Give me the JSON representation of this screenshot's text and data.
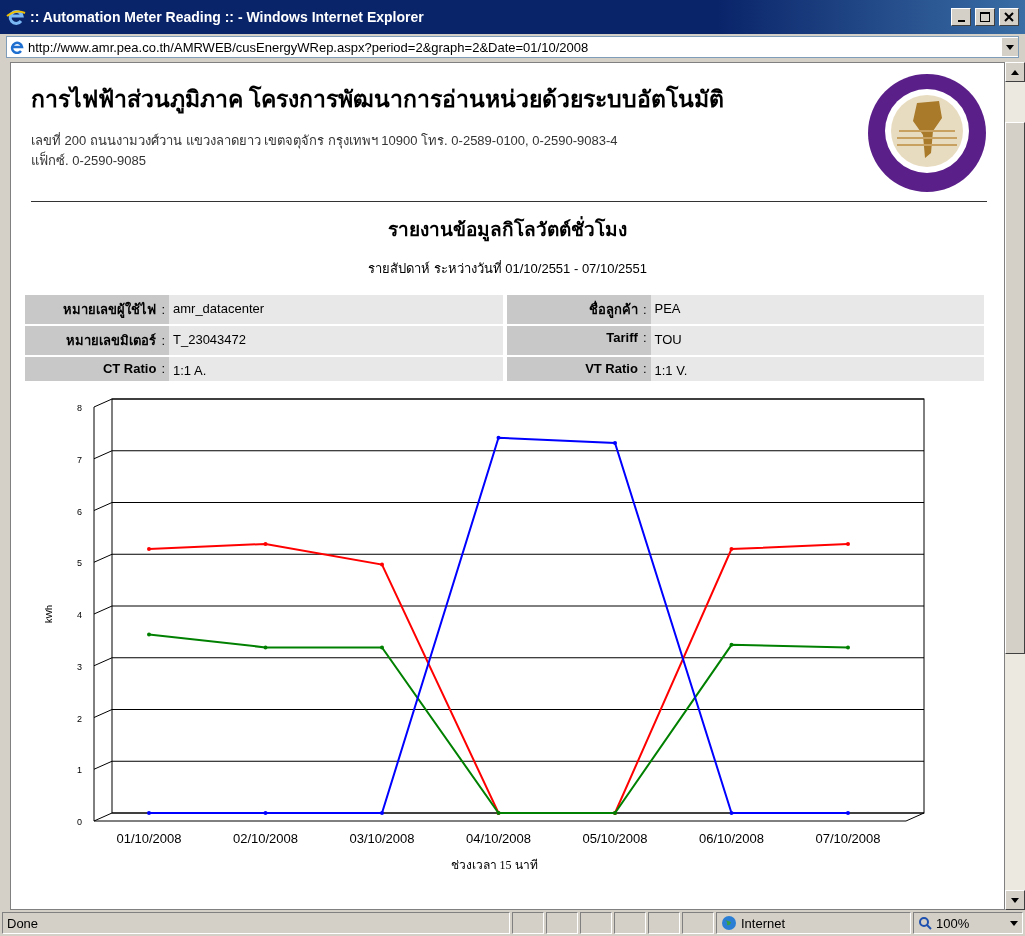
{
  "window": {
    "title": ":: Automation Meter Reading :: - Windows Internet Explorer",
    "address": "http://www.amr.pea.co.th/AMRWEB/cusEnergyWRep.aspx?period=2&graph=2&Date=01/10/2008"
  },
  "header": {
    "title": "การไฟฟ้าส่วนภูมิภาค โครงการพัฒนาการอ่านหน่วยด้วยระบบอัตโนมัติ",
    "address_lines": [
      "เลขที่ 200 ถนนงามวงศ์วาน แขวงลาดยาว เขตจตุจักร กรุงเทพฯ 10900 โทร. 0-2589-0100, 0-2590-9083-4",
      "แฟ็กซ์. 0-2590-9085"
    ]
  },
  "report": {
    "title": "รายงานข้อมูลกิโลวัตต์ชั่วโมง",
    "subtitle": "รายสัปดาห์ ระหว่างวันที่ 01/10/2551 - 07/10/2551",
    "info": [
      [
        {
          "label": "หมายเลขผู้ใช้ไฟ",
          "separator": ":",
          "value": "amr_datacenter"
        },
        {
          "label": "ชื่อลูกค้า",
          "separator": ":",
          "value": "PEA"
        }
      ],
      [
        {
          "label": "หมายเลขมิเตอร์",
          "separator": ":",
          "value": "T_23043472"
        },
        {
          "label": "Tariff",
          "separator": ":",
          "value": "TOU"
        }
      ],
      [
        {
          "label": "CT Ratio",
          "separator": ":",
          "value": "1:1 A."
        },
        {
          "label": "VT Ratio",
          "separator": ":",
          "value": "1:1 V."
        }
      ]
    ],
    "chart_data": {
      "type": "line",
      "xlabel": "ช่วงเวลา 15 นาที",
      "ylabel": "kWh",
      "categories": [
        "01/10/2008",
        "02/10/2008",
        "03/10/2008",
        "04/10/2008",
        "05/10/2008",
        "06/10/2008",
        "07/10/2008"
      ],
      "ylim": [
        0,
        8
      ],
      "yticks": [
        0,
        1,
        2,
        3,
        4,
        5,
        6,
        7,
        8
      ],
      "grid": true,
      "series": [
        {
          "color": "#ff0000",
          "values": [
            5.1,
            5.2,
            4.8,
            0,
            0,
            5.1,
            5.2
          ]
        },
        {
          "color": "#008000",
          "values": [
            3.45,
            3.2,
            3.2,
            0,
            0,
            3.25,
            3.2
          ]
        },
        {
          "color": "#0000ff",
          "values": [
            0,
            0,
            0,
            7.25,
            7.15,
            0,
            0
          ]
        }
      ]
    }
  },
  "status_bar": {
    "text": "Done",
    "zone": "Internet",
    "zoom": "100%"
  }
}
